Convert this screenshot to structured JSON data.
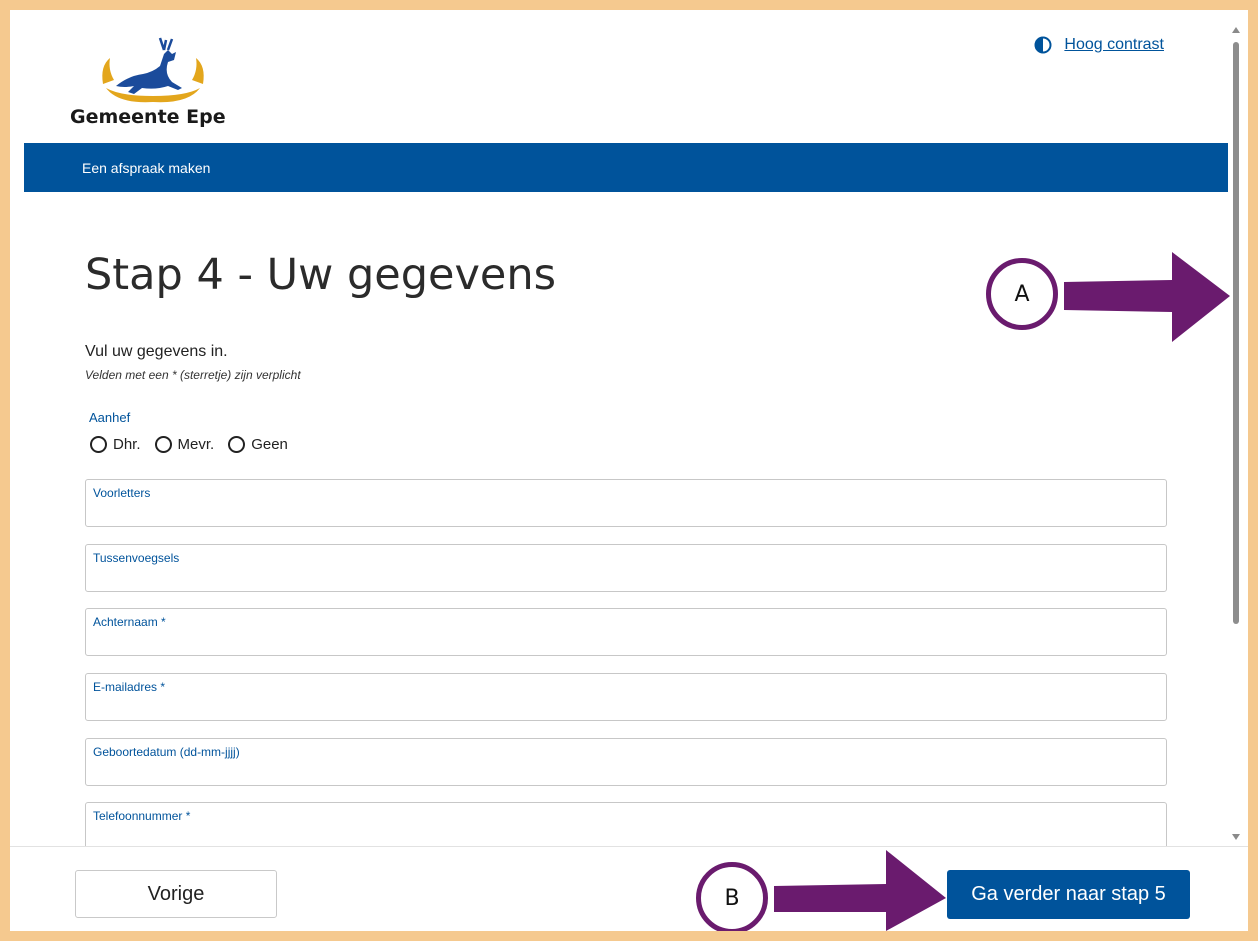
{
  "header": {
    "brand_name": "Gemeente Epe",
    "contrast_link": "Hoog contrast"
  },
  "nav": {
    "title": "Een afspraak maken"
  },
  "main": {
    "title": "Stap 4 - Uw gegevens",
    "intro": "Vul uw gegevens in.",
    "required_note": "Velden met een * (sterretje) zijn verplicht",
    "salutation": {
      "label": "Aanhef",
      "options": [
        "Dhr.",
        "Mevr.",
        "Geen"
      ]
    },
    "fields": [
      {
        "label": "Voorletters",
        "value": ""
      },
      {
        "label": "Tussenvoegsels",
        "value": ""
      },
      {
        "label": "Achternaam *",
        "value": ""
      },
      {
        "label": "E-mailadres *",
        "value": ""
      },
      {
        "label": "Geboortedatum (dd-mm-jjjj)",
        "value": ""
      },
      {
        "label": "Telefoonnummer *",
        "value": ""
      }
    ]
  },
  "footer": {
    "prev_label": "Vorige",
    "next_label": "Ga verder naar stap 5"
  },
  "annotations": {
    "a_label": "A",
    "b_label": "B"
  },
  "colors": {
    "brand_blue": "#00539b",
    "annotation_purple": "#6a1b6e",
    "frame_border": "#f5c98f"
  }
}
